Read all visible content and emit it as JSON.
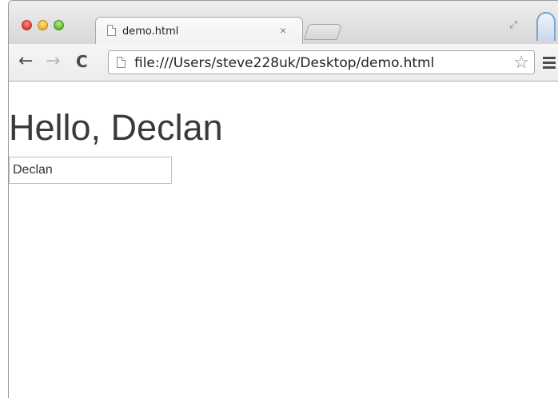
{
  "browser": {
    "tab": {
      "title": "demo.html",
      "close_glyph": "×",
      "icon": "page-icon"
    },
    "restore_glyph": "⤢",
    "address_bar": {
      "url": "file:///Users/steve228uk/Desktop/demo.html",
      "icon": "page-icon"
    },
    "toolbar": {
      "back_glyph": "←",
      "forward_glyph": "→",
      "reload_glyph": "C",
      "star_glyph": "☆"
    }
  },
  "page": {
    "greeting": "Hello, Declan",
    "name_input": {
      "value": "Declan"
    }
  }
}
